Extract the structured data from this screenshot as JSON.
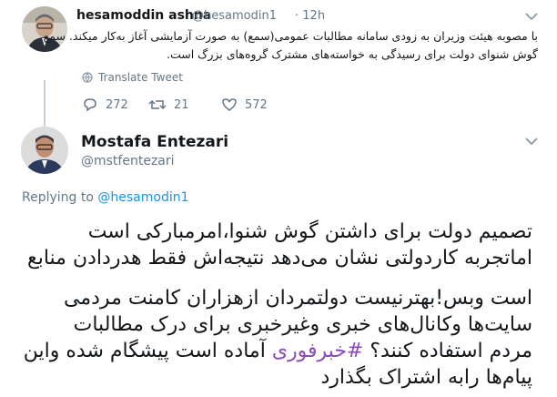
{
  "quoted_tweet": {
    "author_name": "hesamoddin ashna",
    "author_handle": "@hesamodin1",
    "separator": "·",
    "time": "12h",
    "text_lines": [
      "با مصوبه هیئت وزیران به زودی سامانه مطالبات عمومی(سمع) به صورت آزمایشی آغاز به‌کار میکند. سمع",
      "گوش شنوای دولت برای رسیدگی به خواسته‌های مشترک گروه‌های بزرگ است."
    ],
    "translate_label": "Translate Tweet",
    "replies_count": "272",
    "retweets_count": "21",
    "likes_count": "572"
  },
  "main_tweet": {
    "author_name": "Mostafa Entezari",
    "author_handle": "@mstfentezari",
    "replying_prefix": "Replying to",
    "replying_to": "@hesamodin1",
    "text_lines": [
      "تصمیم دولت برای داشتن گوش شنوا،امرمبارکی است",
      "اماتجربه کاردولتی نشان می‌دهد نتیجه‌اش فقط هدردادن منابع",
      "است وبس!بهترنیست دولتمردان ازهزاران کامنت مردمی",
      "سایت‌ها وکانال‌های خبری وغیرخبری برای درک مطالبات"
    ],
    "line5_before": "مردم استفاده کنند؟ ",
    "hashtag": "#خبرفوری",
    "line5_after": " آماده است پیشگام شده واین",
    "line6": "پیام‌ها رابه اشتراک بگذارد"
  },
  "colors": {
    "link": "#1b95e0",
    "hashtag": "#8a4bb8",
    "muted": "#657786",
    "thread_line": "#c4cfd6"
  },
  "icons": [
    "chevron-down-icon",
    "globe-icon",
    "reply-icon",
    "retweet-icon",
    "like-icon"
  ]
}
